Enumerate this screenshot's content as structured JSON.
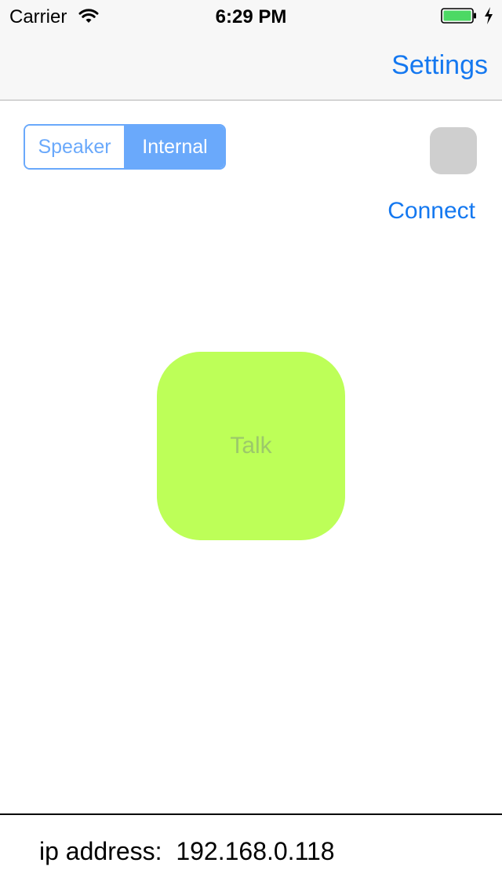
{
  "status_bar": {
    "carrier": "Carrier",
    "time": "6:29 PM",
    "battery_color": "#4cd964",
    "icons": [
      "wifi-icon",
      "battery-icon",
      "charging-bolt-icon"
    ]
  },
  "nav": {
    "settings_label": "Settings"
  },
  "audio_output": {
    "options": [
      "Speaker",
      "Internal"
    ],
    "selected": "Internal"
  },
  "connection": {
    "indicator_color": "#cfcfcf",
    "connect_label": "Connect"
  },
  "talk": {
    "label": "Talk",
    "color": "#bdff58"
  },
  "footer": {
    "ip_label": "ip address:",
    "ip_value": "192.168.0.118"
  },
  "colors": {
    "accent": "#1478f0",
    "segment_accent": "#6aa9fb"
  }
}
